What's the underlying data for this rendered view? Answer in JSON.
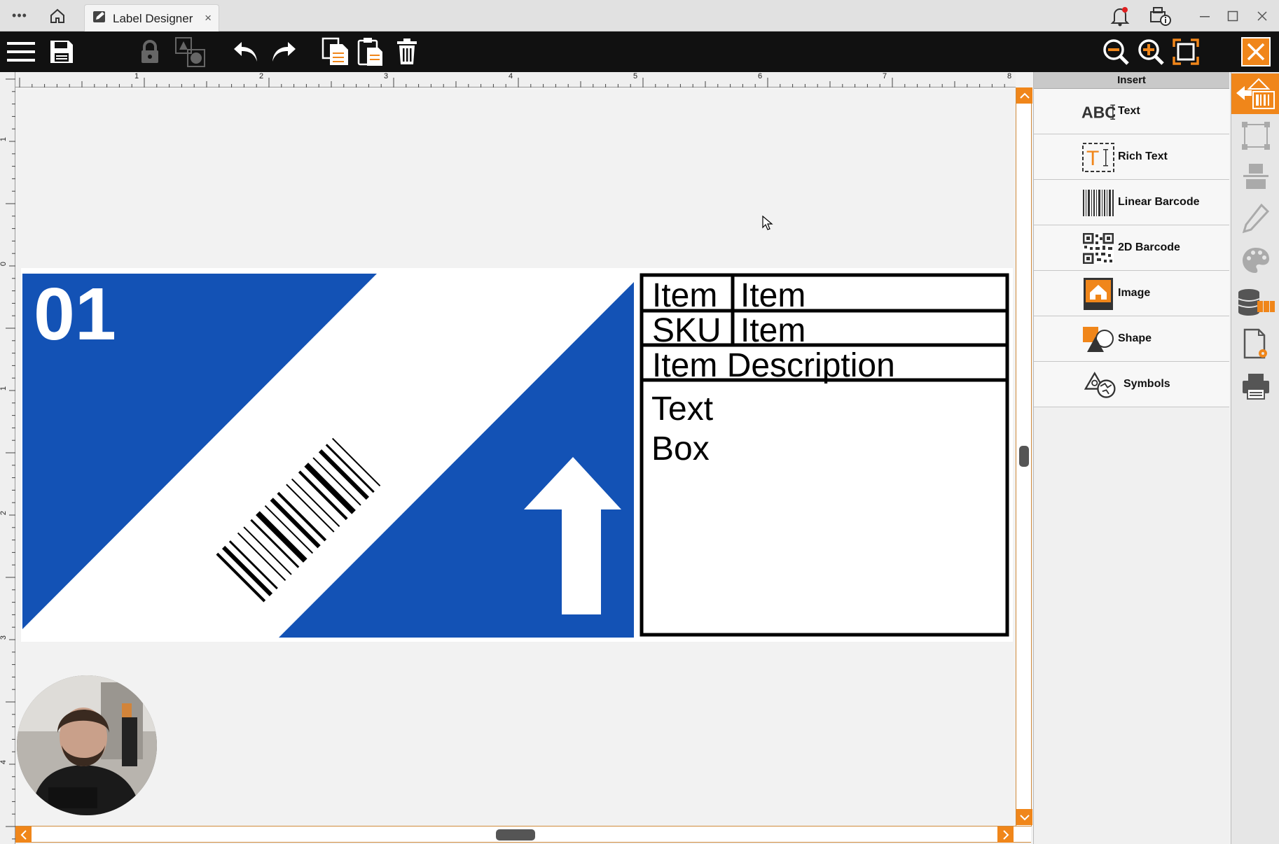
{
  "titlebar": {
    "tab_label": "Label Designer",
    "tab_close": "×",
    "menu_dots": "•••"
  },
  "canvas": {
    "ruler_top_numbers": [
      "1",
      "2",
      "3",
      "4",
      "5",
      "6",
      "7",
      "8"
    ],
    "ruler_left_numbers": [
      "1",
      "0",
      "1",
      "2",
      "3",
      "4"
    ]
  },
  "label": {
    "number": "01",
    "table": {
      "row1_left": "Item",
      "row1_right": "Item",
      "row2_left": "SKU",
      "row2_right": "Item",
      "row3": "Item Description",
      "text_box_line1": "Text",
      "text_box_line2": "Box"
    },
    "colors": {
      "blue": "#1352b5",
      "black": "#000000",
      "white": "#ffffff"
    }
  },
  "insert_panel": {
    "title": "Insert",
    "items": [
      {
        "label": "Text",
        "icon": "text-abc-icon"
      },
      {
        "label": "Rich Text",
        "icon": "rich-text-icon"
      },
      {
        "label": "Linear Barcode",
        "icon": "linear-barcode-icon"
      },
      {
        "label": "2D Barcode",
        "icon": "qr-code-icon"
      },
      {
        "label": "Image",
        "icon": "image-icon"
      },
      {
        "label": "Shape",
        "icon": "shape-icon"
      },
      {
        "label": "Symbols",
        "icon": "symbols-icon"
      }
    ]
  },
  "colors": {
    "accent": "#f0861a",
    "toolbar": "#111111"
  }
}
